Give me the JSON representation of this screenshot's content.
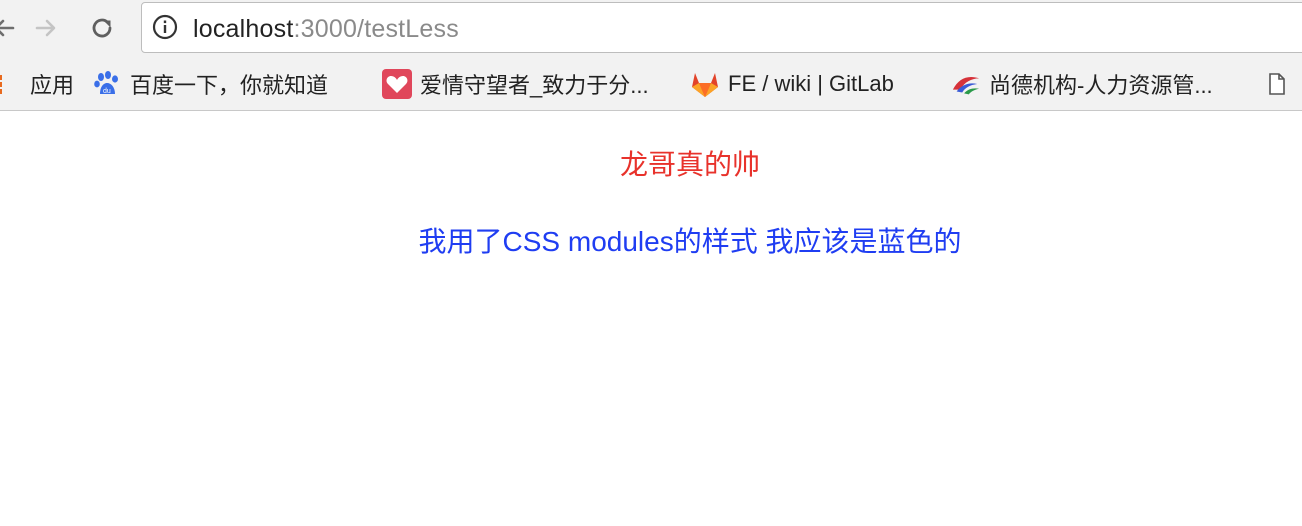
{
  "browser": {
    "url_host": "localhost",
    "url_path": ":3000/testLess",
    "nav": {
      "back_icon": "arrow-left-icon",
      "forward_icon": "arrow-right-icon",
      "reload_icon": "reload-icon",
      "info_icon": "info-icon"
    }
  },
  "bookmarks": {
    "items": [
      {
        "label": "应用",
        "icon": "apps-grid-icon"
      },
      {
        "label": "百度一下，你就知道",
        "icon": "baidu-paw-icon"
      },
      {
        "label": "爱情守望者_致力于分...",
        "icon": "heart-icon"
      },
      {
        "label": "FE / wiki | GitLab",
        "icon": "gitlab-fox-icon"
      },
      {
        "label": "尚德机构-人力资源管...",
        "icon": "shangde-logo-icon"
      },
      {
        "label": "",
        "icon": "file-icon"
      }
    ]
  },
  "page": {
    "red_line": "龙哥真的帅",
    "blue_line": "我用了CSS modules的样式 我应该是蓝色的"
  },
  "colors": {
    "red_text": "#e8322b",
    "blue_text": "#1f3df2"
  }
}
